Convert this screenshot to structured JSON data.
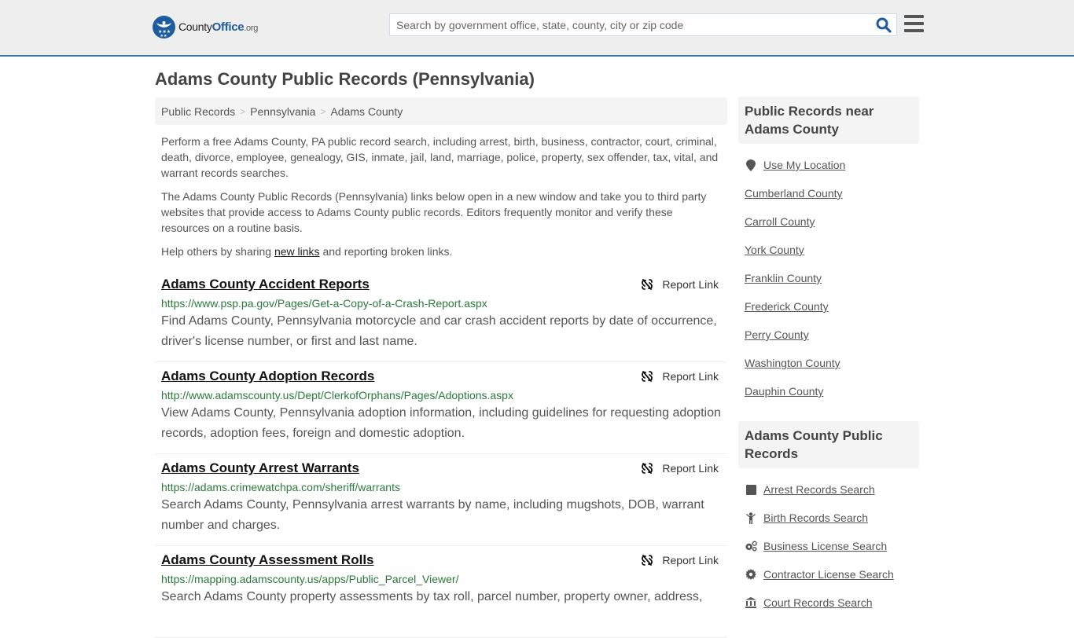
{
  "header": {
    "logo_main": "County",
    "logo_accent": "Office",
    "logo_suffix": ".org",
    "search_placeholder": "Search by government office, state, county, city or zip code",
    "search_value": "",
    "accent_color": "#3a78aa",
    "brand_color": "#1d5c9e"
  },
  "page_title": "Adams County Public Records (Pennsylvania)",
  "breadcrumb": [
    "Public Records",
    "Pennsylvania",
    "Adams County"
  ],
  "intro": {
    "p1": "Perform a free Adams County, PA public record search, including arrest, birth, business, contractor, court, criminal, death, divorce, employee, genealogy, GIS, inmate, jail, land, marriage, police, property, sex offender, tax, vital, and warrant records searches.",
    "p2": "The Adams County Public Records (Pennsylvania) links below open in a new window and take you to third party websites that provide access to Adams County public records. Editors frequently monitor and verify these resources on a routine basis.",
    "p3_before": "Help others by sharing ",
    "p3_link": "new links",
    "p3_after": " and reporting broken links."
  },
  "report_label": "Report Link",
  "records": [
    {
      "title": "Adams County Accident Reports",
      "url": "https://www.psp.pa.gov/Pages/Get-a-Copy-of-a-Crash-Report.aspx",
      "description": "Find Adams County, Pennsylvania motorcycle and car crash accident reports by date of occurrence, driver's license number, or first and last name."
    },
    {
      "title": "Adams County Adoption Records",
      "url": "http://www.adamscounty.us/Dept/ClerkofOrphans/Pages/Adoptions.aspx",
      "description": "View Adams County, Pennsylvania adoption information, including guidelines for requesting adoption records, adoption fees, foreign and domestic adoption."
    },
    {
      "title": "Adams County Arrest Warrants",
      "url": "https://adams.crimewatchpa.com/sheriff/warrants",
      "description": "Search Adams County, Pennsylvania arrest warrants by name, including mugshots, DOB, warrant number and charges."
    },
    {
      "title": "Adams County Assessment Rolls",
      "url": "https://mapping.adamscounty.us/apps/Public_Parcel_Viewer/",
      "description": "Search Adams County property assessments by tax roll, parcel number, property owner, address,"
    }
  ],
  "sidebar": {
    "nearby_title": "Public Records near Adams County",
    "use_location": "Use My Location",
    "nearby": [
      "Cumberland County",
      "Carroll County",
      "York County",
      "Franklin County",
      "Frederick County",
      "Perry County",
      "Washington County",
      "Dauphin County"
    ],
    "county_title": "Adams County Public Records",
    "county_links": [
      {
        "label": "Arrest Records Search",
        "icon": "square-icon"
      },
      {
        "label": "Birth Records Search",
        "icon": "child-icon"
      },
      {
        "label": "Business License Search",
        "icon": "gears-icon"
      },
      {
        "label": "Contractor License Search",
        "icon": "gear-icon"
      },
      {
        "label": "Court Records Search",
        "icon": "courthouse-icon"
      }
    ]
  }
}
